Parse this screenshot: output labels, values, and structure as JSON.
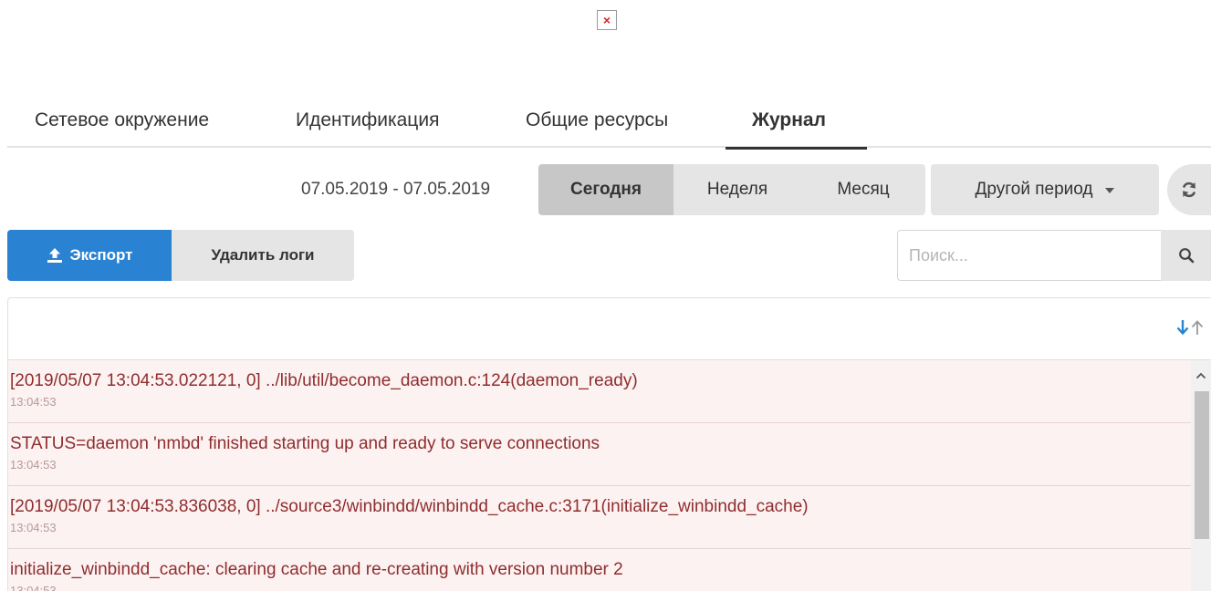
{
  "broken_image": {
    "glyph": "×"
  },
  "tabs": [
    {
      "label": "Сетевое окружение",
      "active": false
    },
    {
      "label": "Идентификация",
      "active": false
    },
    {
      "label": "Общие ресурсы",
      "active": false
    },
    {
      "label": "Журнал",
      "active": true
    }
  ],
  "filter": {
    "date_range": "07.05.2019 - 07.05.2019",
    "periods": [
      {
        "label": "Сегодня",
        "active": true
      },
      {
        "label": "Неделя",
        "active": false
      },
      {
        "label": "Месяц",
        "active": false
      }
    ],
    "other_period_label": "Другой период",
    "refresh_icon": "refresh-icon"
  },
  "toolbar": {
    "export_label": "Экспорт",
    "export_icon": "upload-icon",
    "delete_label": "Удалить логи",
    "search_placeholder": "Поиск...",
    "search_value": "",
    "search_icon": "search-icon"
  },
  "colors": {
    "primary": "#2a82d3",
    "log_row_bg": "#fdf2f2",
    "log_text": "#8f2d2d",
    "sort_active": "#2a82d3"
  },
  "logs": [
    {
      "message": "[2019/05/07 13:04:53.022121, 0] ../lib/util/become_daemon.c:124(daemon_ready)",
      "time": "13:04:53"
    },
    {
      "message": "STATUS=daemon 'nmbd' finished starting up and ready to serve connections",
      "time": "13:04:53"
    },
    {
      "message": "[2019/05/07 13:04:53.836038, 0] ../source3/winbindd/winbindd_cache.c:3171(initialize_winbindd_cache)",
      "time": "13:04:53"
    },
    {
      "message": "initialize_winbindd_cache: clearing cache and re-creating with version number 2",
      "time": "13:04:53"
    }
  ]
}
